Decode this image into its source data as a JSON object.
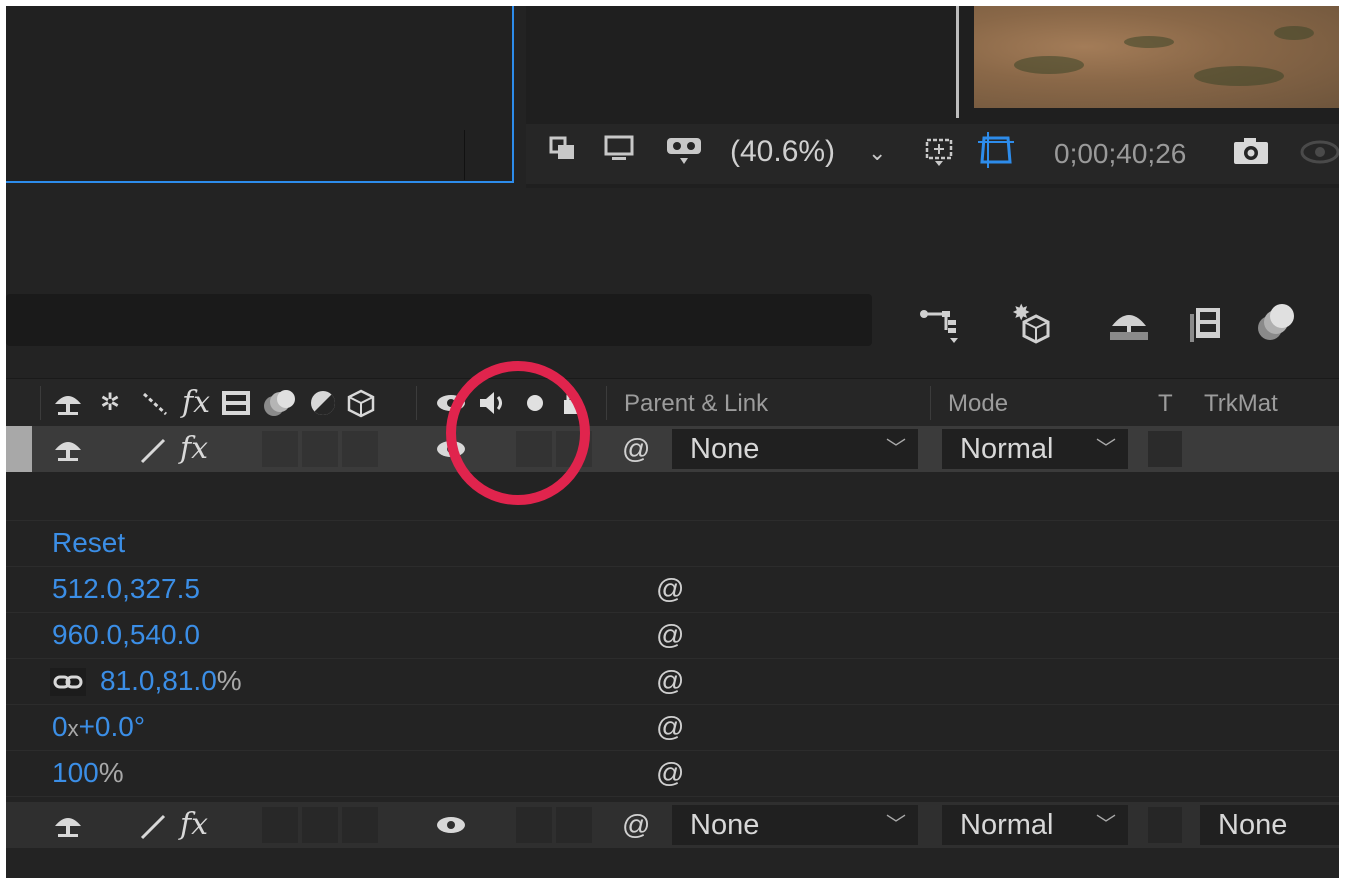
{
  "viewer": {
    "zoom_label": "(40.6%)",
    "zoom_arrow": "⌄",
    "timecode": "0;00;40;26",
    "icons": [
      "toggle-mask-icon",
      "display-icon",
      "vr-goggles-icon",
      "region-of-interest-icon",
      "transparency-grid-icon",
      "camera-icon"
    ]
  },
  "toolbar": {
    "icons": [
      "flowchart-icon",
      "3d-draft-icon",
      "shy-layers-icon",
      "frame-blending-icon",
      "motion-blur-icon"
    ]
  },
  "columns": {
    "parent_link": "Parent & Link",
    "mode": "Mode",
    "t": "T",
    "trkmat": "TrkMat"
  },
  "layer1": {
    "parent": "None",
    "mode": "Normal"
  },
  "layer2": {
    "parent": "None",
    "mode": "Normal",
    "trkmat": "None"
  },
  "properties": {
    "reset": "Reset",
    "anchor_point": "512.0,327.5",
    "position": "960.0,540.0",
    "scale": "81.0,81.0",
    "scale_unit": "%",
    "rotation_turns": "0",
    "rotation_x": "x",
    "rotation_degrees": "+0.0°",
    "opacity": "100",
    "opacity_unit": "%"
  },
  "highlight": {
    "color": "#e0244d"
  },
  "colors": {
    "accent_blue": "#3b8ee6",
    "panel_border": "#2d8ceb"
  }
}
